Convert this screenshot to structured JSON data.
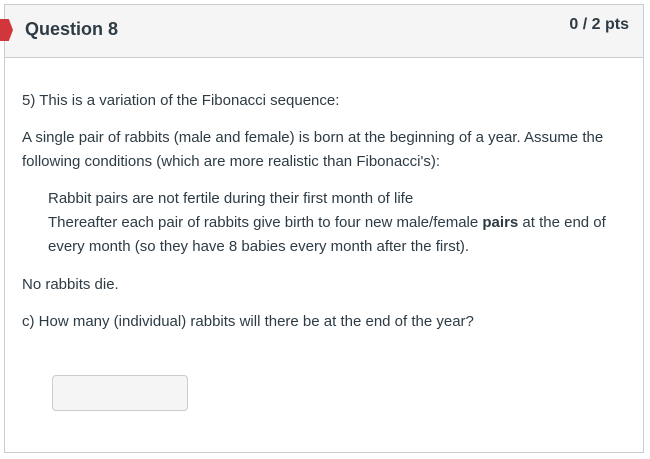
{
  "question": {
    "title": "Question 8",
    "points": "0 / 2 pts"
  },
  "content": {
    "intro": "5) This is a variation of the Fibonacci sequence:",
    "setup": "A single pair of rabbits (male and female) is born at the beginning of a year.  Assume the following conditions (which are more realistic than Fibonacci's):",
    "condition1": "Rabbit pairs are not fertile during their first month of life",
    "condition2_before": "Thereafter each pair of rabbits give birth to four new male/female ",
    "condition2_bold": "pairs",
    "condition2_after": " at the end of every month (so they have 8 babies every month after the first).",
    "no_die": "No rabbits die.",
    "part_c": "c) How many (individual) rabbits will there be at the end of the year?"
  },
  "answer": {
    "value": ""
  },
  "colors": {
    "flag": "#d0363a",
    "header_bg": "#f5f5f5",
    "border": "#c7cdd1",
    "text": "#2d3b45"
  }
}
